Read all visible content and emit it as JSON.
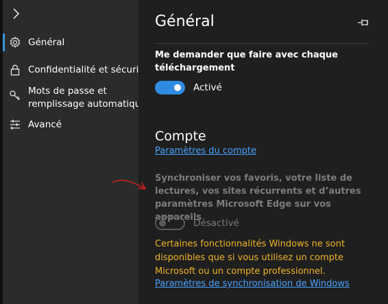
{
  "nav": {
    "items": [
      {
        "label": "Général",
        "icon": "gear-icon"
      },
      {
        "label": "Confidentialité et sécurité",
        "icon": "lock-icon"
      },
      {
        "label": "Mots de passe et",
        "label2": "remplissage automatique",
        "icon": "key-icon"
      },
      {
        "label": "Avancé",
        "icon": "sliders-icon"
      }
    ]
  },
  "main": {
    "title": "Général",
    "download_prompt": {
      "label": "Me demander que faire avec chaque téléchargement",
      "state": "Activé",
      "on": true
    },
    "account": {
      "title": "Compte",
      "settings_link": "Paramètres du compte",
      "sync_label": "Synchroniser vos favoris, votre liste de lectures, vos sites récurrents et d’autres paramètres Microsoft Edge sur vos appareils",
      "sync_state": "Désactivé",
      "sync_on": false,
      "warning": "Certaines fonctionnalités Windows ne sont disponibles que si vous utilisez un compte Microsoft ou un compte professionnel.",
      "sync_settings_link": "Paramètres de synchronisation de Windows"
    }
  },
  "colors": {
    "accent": "#2f8ce0",
    "link": "#4aa3ff",
    "warning": "#f0b429",
    "annotation_arrow": "#d42020"
  }
}
